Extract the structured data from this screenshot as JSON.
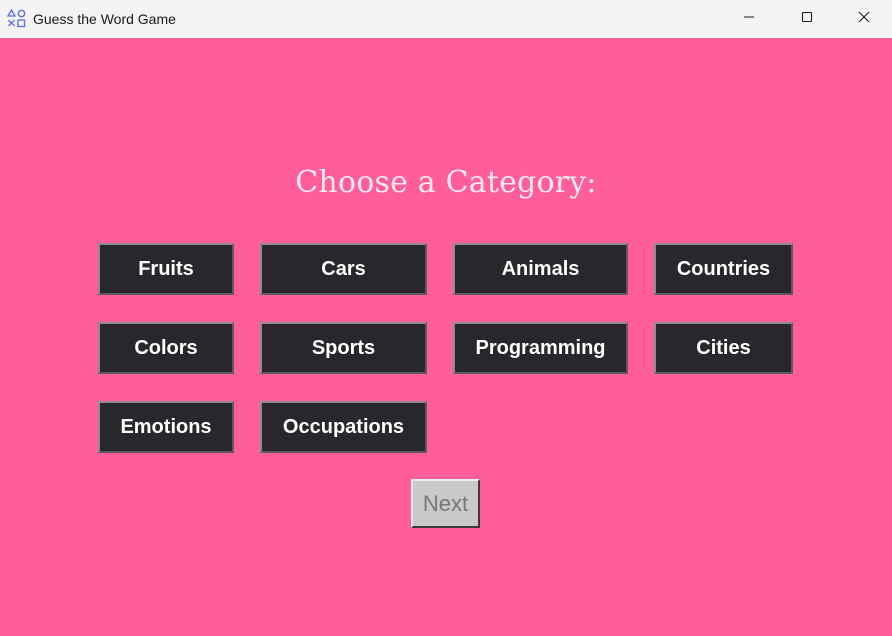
{
  "window": {
    "title": "Guess the Word Game",
    "app_icon": "shapes-icon",
    "controls": {
      "minimize_icon": "minimize-icon",
      "maximize_icon": "maximize-icon",
      "close_icon": "close-icon"
    }
  },
  "main": {
    "heading": "Choose a Category:",
    "categories": [
      "Fruits",
      "Cars",
      "Animals",
      "Countries",
      "Colors",
      "Sports",
      "Programming",
      "Cities",
      "Emotions",
      "Occupations"
    ],
    "next_label": "Next"
  },
  "colors": {
    "background": "#ff5e99",
    "button_bg": "#29272b",
    "button_text": "#ffffff",
    "next_bg": "#c9c9c9",
    "next_text": "#777777",
    "heading_text": "#ffe8f0"
  }
}
